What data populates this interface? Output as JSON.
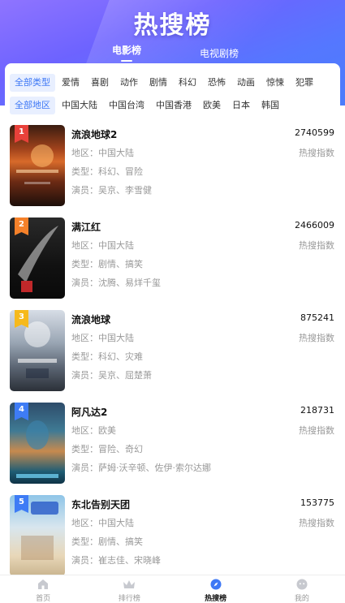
{
  "header": {
    "title": "热搜榜"
  },
  "top_tabs": [
    {
      "label": "电影榜",
      "active": true
    },
    {
      "label": "电视剧榜",
      "active": false
    }
  ],
  "filters": {
    "types": [
      "全部类型",
      "爱情",
      "喜剧",
      "动作",
      "剧情",
      "科幻",
      "恐怖",
      "动画",
      "惊悚",
      "犯罪"
    ],
    "regions": [
      "全部地区",
      "中国大陆",
      "中国台湾",
      "中国香港",
      "欧美",
      "日本",
      "韩国"
    ],
    "active_type": "全部类型",
    "active_region": "全部地区"
  },
  "heat_label": "热搜指数",
  "movies": [
    {
      "rank": "1",
      "title": "流浪地球2",
      "score": "2740599",
      "region": "地区：中国大陆",
      "genre": "类型：科幻、冒险",
      "cast": "演员：吴京、李雪健"
    },
    {
      "rank": "2",
      "title": "满江红",
      "score": "2466009",
      "region": "地区：中国大陆",
      "genre": "类型：剧情、搞笑",
      "cast": "演员：沈腾、易烊千玺"
    },
    {
      "rank": "3",
      "title": "流浪地球",
      "score": "875241",
      "region": "地区：中国大陆",
      "genre": "类型：科幻、灾难",
      "cast": "演员：吴京、屈楚萧"
    },
    {
      "rank": "4",
      "title": "阿凡达2",
      "score": "218731",
      "region": "地区：欧美",
      "genre": "类型：冒险、奇幻",
      "cast": "演员：萨姆·沃辛顿、佐伊·索尔达娜"
    },
    {
      "rank": "5",
      "title": "东北告别天团",
      "score": "153775",
      "region": "地区：中国大陆",
      "genre": "类型：剧情、搞笑",
      "cast": "演员：崔志佳、宋晓峰"
    }
  ],
  "rank_colors": [
    "#e8413a",
    "#f5812a",
    "#f6b91c",
    "#3e7cf5",
    "#3e7cf5"
  ],
  "bottom_nav": [
    {
      "label": "首页",
      "icon": "home-icon",
      "active": false
    },
    {
      "label": "排行榜",
      "icon": "crown-icon",
      "active": false
    },
    {
      "label": "热搜榜",
      "icon": "compass-icon",
      "active": true
    },
    {
      "label": "我的",
      "icon": "profile-icon",
      "active": false
    }
  ],
  "colors": {
    "accent": "#3e78f5",
    "hero_start": "#8f74ff",
    "hero_end": "#4b7dfb"
  }
}
